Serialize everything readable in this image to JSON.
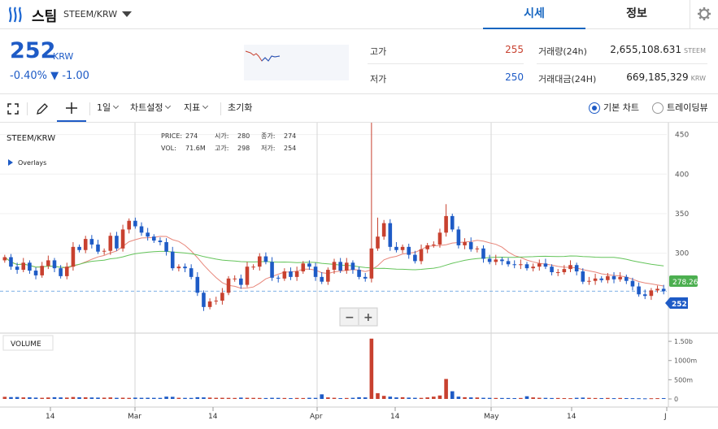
{
  "header": {
    "coin_name": "스팀",
    "pair": "STEEM/KRW",
    "tabs": [
      {
        "label": "시세",
        "active": true
      },
      {
        "label": "정보",
        "active": false
      }
    ]
  },
  "summary": {
    "price": "252",
    "price_unit": "KRW",
    "change": "-0.40% ▼ -1.00",
    "high_label": "고가",
    "high": "255",
    "low_label": "저가",
    "low": "250",
    "volume_label": "거래량(24h)",
    "volume": "2,655,108.631",
    "volume_unit": "STEEM",
    "value_label": "거래대금(24H)",
    "value": "669,185,329",
    "value_unit": "KRW"
  },
  "toolbar": {
    "interval": "1일",
    "chart_settings": "차트설정",
    "indicators": "지표",
    "reset": "초기화",
    "view_basic": "기본 차트",
    "view_tradingview": "트레이딩뷰"
  },
  "chart": {
    "symbol": "STEEM/KRW",
    "overlays": "Overlays",
    "legend": {
      "price_label": "PRICE:",
      "price": "274",
      "vol_label": "VOL:",
      "vol": "71.6M",
      "open_label": "시가:",
      "open": "280",
      "high_label": "고가:",
      "high": "298",
      "close_label": "종가:",
      "close": "274",
      "low_label": "저가:",
      "low": "254"
    },
    "volume_pane_label": "VOLUME",
    "ma_long_label": "278.26",
    "last_price_label": "252",
    "zoom_out": "−",
    "zoom_in": "+",
    "colors": {
      "up": "#c8412f",
      "down": "#1e5bc6",
      "ma_short": "#e8867a",
      "ma_long": "#64c45a"
    }
  },
  "chart_data": {
    "type": "candlestick",
    "y_ticks": [
      450,
      400,
      350,
      300
    ],
    "ylim": [
      200,
      465
    ],
    "volume_ticks": [
      "1.50b",
      "1000m",
      "500m",
      "0"
    ],
    "x_ticks": [
      "14",
      "Mar",
      "14",
      "Apr",
      "14",
      "May",
      "14",
      "J"
    ],
    "close": [
      295,
      283,
      279,
      288,
      278,
      272,
      284,
      291,
      281,
      271,
      283,
      308,
      304,
      318,
      311,
      302,
      303,
      322,
      306,
      330,
      341,
      334,
      326,
      321,
      316,
      314,
      302,
      281,
      283,
      281,
      270,
      250,
      232,
      239,
      240,
      250,
      268,
      268,
      260,
      283,
      283,
      296,
      289,
      269,
      268,
      277,
      270,
      277,
      287,
      283,
      270,
      264,
      279,
      289,
      278,
      288,
      279,
      270,
      268,
      306,
      321,
      338,
      308,
      304,
      308,
      298,
      290,
      305,
      310,
      311,
      326,
      347,
      330,
      310,
      314,
      305,
      306,
      293,
      289,
      292,
      290,
      286,
      285,
      286,
      281,
      283,
      287,
      283,
      276,
      276,
      280,
      285,
      277,
      264,
      265,
      268,
      266,
      271,
      267,
      270,
      265,
      258,
      248,
      246,
      253,
      255,
      252
    ],
    "volume_m": [
      55,
      48,
      50,
      40,
      42,
      35,
      30,
      38,
      45,
      40,
      36,
      50,
      44,
      42,
      38,
      35,
      33,
      40,
      30,
      32,
      28,
      34,
      30,
      31,
      29,
      28,
      60,
      55,
      30,
      28,
      27,
      45,
      40,
      35,
      30,
      30,
      28,
      26,
      35,
      30,
      28,
      26,
      24,
      30,
      28,
      25,
      22,
      26,
      24,
      30,
      28,
      120,
      40,
      30,
      22,
      25,
      30,
      45,
      40,
      1570,
      150,
      80,
      60,
      40,
      45,
      35,
      30,
      28,
      40,
      60,
      90,
      520,
      200,
      60,
      45,
      40,
      38,
      30,
      28,
      26,
      25,
      24,
      22,
      25,
      70,
      40,
      30,
      28,
      24,
      25,
      22,
      20,
      30,
      35,
      28,
      24,
      22,
      26,
      20,
      25,
      22,
      20,
      18,
      15,
      18,
      20,
      22
    ]
  }
}
